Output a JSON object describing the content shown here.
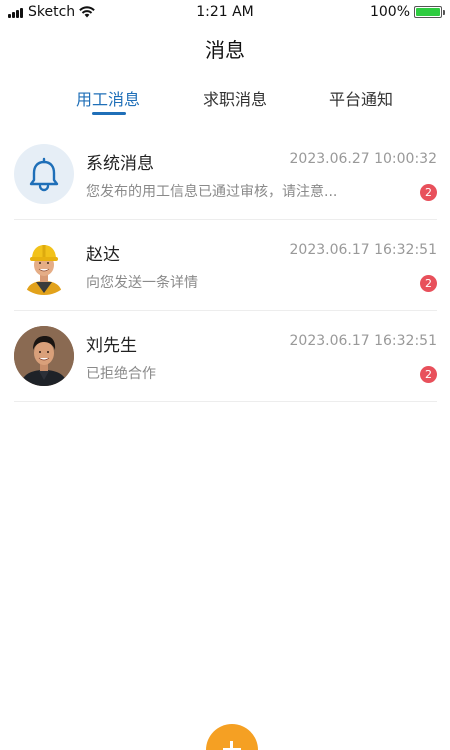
{
  "status_bar": {
    "carrier": "Sketch",
    "time": "1:21 AM",
    "battery": "100%",
    "battery_level": 1.0
  },
  "header": {
    "title": "消息"
  },
  "tabs": [
    {
      "label": "用工消息",
      "active": true
    },
    {
      "label": "求职消息",
      "active": false
    },
    {
      "label": "平台通知",
      "active": false
    }
  ],
  "messages": [
    {
      "name": "系统消息",
      "time": "2023.06.27 10:00:32",
      "preview": "您发布的用工信息已通过审核，请注意...",
      "badge": "2",
      "avatar": "bell-icon"
    },
    {
      "name": "赵达",
      "time": "2023.06.17 16:32:51",
      "preview": "向您发送一条详情",
      "badge": "2",
      "avatar": "worker-avatar"
    },
    {
      "name": "刘先生",
      "time": "2023.06.17 16:32:51",
      "preview": "已拒绝合作",
      "badge": "2",
      "avatar": "person-avatar"
    }
  ],
  "colors": {
    "accent": "#1f6fb8",
    "badge": "#e8505b",
    "add_button": "#f5a023",
    "battery": "#2ecc40"
  },
  "bottom_bar": {
    "add_icon": "plus-icon"
  }
}
